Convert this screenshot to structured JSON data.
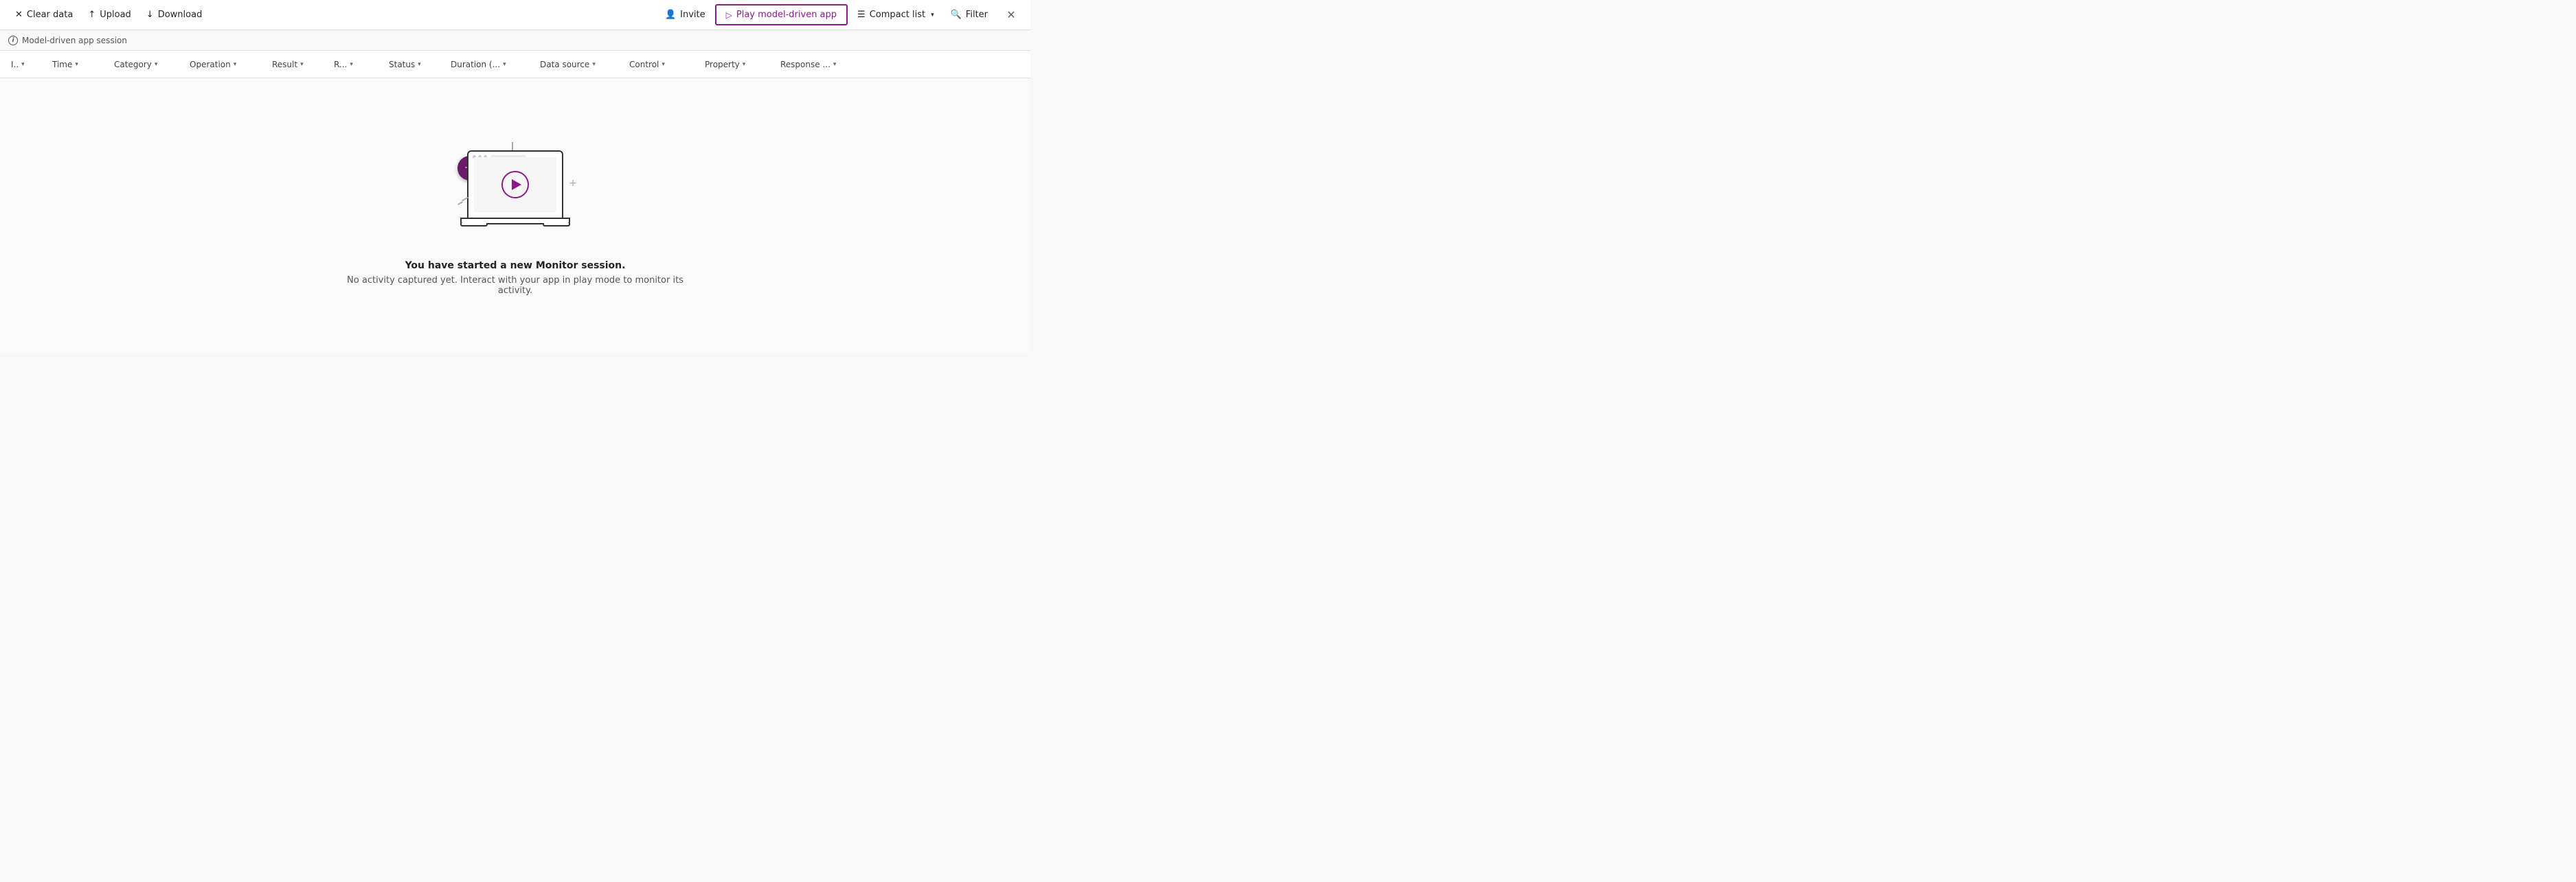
{
  "toolbar": {
    "clear_data_label": "Clear data",
    "upload_label": "Upload",
    "download_label": "Download",
    "invite_label": "Invite",
    "play_model_driven_label": "Play model-driven app",
    "compact_list_label": "Compact list",
    "filter_label": "Filter"
  },
  "session_bar": {
    "label": "Model-driven app session"
  },
  "columns": [
    {
      "id": "col-id",
      "label": "I..",
      "short": true
    },
    {
      "id": "col-time",
      "label": "Time"
    },
    {
      "id": "col-category",
      "label": "Category"
    },
    {
      "id": "col-operation",
      "label": "Operation"
    },
    {
      "id": "col-result",
      "label": "Result"
    },
    {
      "id": "col-r",
      "label": "R..."
    },
    {
      "id": "col-status",
      "label": "Status"
    },
    {
      "id": "col-duration",
      "label": "Duration (..."
    },
    {
      "id": "col-datasource",
      "label": "Data source"
    },
    {
      "id": "col-control",
      "label": "Control"
    },
    {
      "id": "col-property",
      "label": "Property"
    },
    {
      "id": "col-response",
      "label": "Response ..."
    }
  ],
  "empty_state": {
    "title": "You have started a new Monitor session.",
    "subtitle": "No activity captured yet. Interact with your app in play mode to monitor its activity."
  }
}
